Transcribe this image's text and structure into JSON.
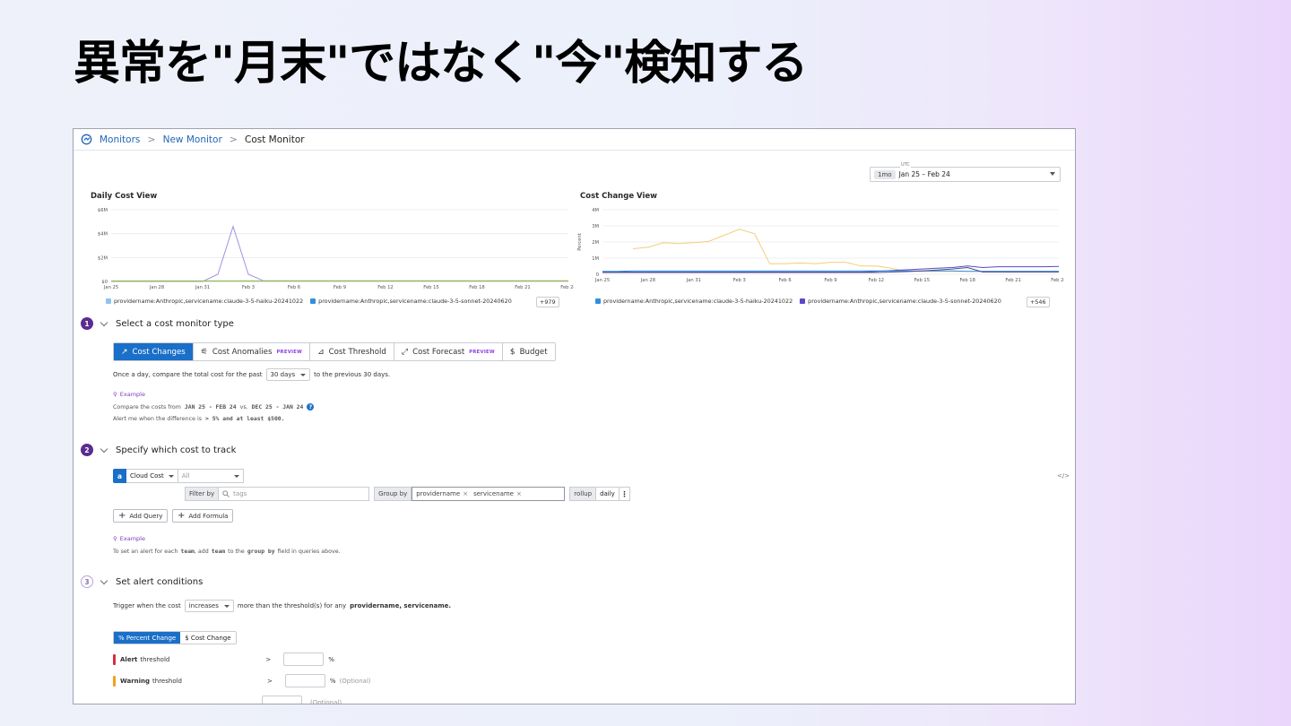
{
  "slide": {
    "title": "異常を\"月末\"ではなく\"今\"検知する"
  },
  "breadcrumb": {
    "monitors": "Monitors",
    "new_monitor": "New Monitor",
    "current": "Cost Monitor",
    "separator": ">"
  },
  "date_range": {
    "utc_label": "UTC",
    "badge": "1mo",
    "range": "Jan 25 – Feb 24"
  },
  "daily_cost_chart": {
    "title": "Daily Cost View",
    "more_badge": "+979",
    "legend": [
      "providername:Anthropic,servicename:claude-3-5-haiku-20241022",
      "providername:Anthropic,servicename:claude-3-5-sonnet-20240620"
    ],
    "colors": [
      "#8fc4f0",
      "#2f8fe0"
    ]
  },
  "cost_change_chart": {
    "title": "Cost Change View",
    "more_badge": "+546",
    "legend": [
      "providername:Anthropic,servicename:claude-3-5-haiku-20241022",
      "providername:Anthropic,servicename:claude-3-5-sonnet-20240620"
    ],
    "colors": [
      "#2f8fe0",
      "#5b47c7"
    ]
  },
  "chart_data": [
    {
      "type": "line",
      "title": "Daily Cost View",
      "xlabel": "",
      "ylabel": "",
      "x_ticks": [
        "Jan 25",
        "Jan 28",
        "Jan 31",
        "Feb 3",
        "Feb 6",
        "Feb 9",
        "Feb 12",
        "Feb 15",
        "Feb 18",
        "Feb 21",
        "Feb 24"
      ],
      "y_ticks": [
        "$6M",
        "$4M",
        "$2M",
        "$0"
      ],
      "ylim": [
        0,
        6
      ],
      "x": [
        0,
        1,
        2,
        3,
        4,
        5,
        6,
        7,
        8,
        9,
        10,
        11,
        12,
        13,
        14,
        15,
        16,
        17,
        18,
        19,
        20,
        21,
        22,
        23,
        24,
        25,
        26,
        27,
        28,
        29,
        30
      ],
      "series": [
        {
          "color": "#a48ee0",
          "values": [
            0,
            0,
            0,
            0,
            0,
            0,
            0,
            0.6,
            4.6,
            0.6,
            0.05,
            0.05,
            0.05,
            0.05,
            0.05,
            0.05,
            0.05,
            0.05,
            0.05,
            0.05,
            0.05,
            0.05,
            0.05,
            0.05,
            0.05,
            0.05,
            0.05,
            0.05,
            0.05,
            0.05,
            0.05
          ]
        },
        {
          "color": "#e8c66a",
          "values": [
            0.05,
            0.05,
            0.05,
            0.05,
            0.05,
            0.05,
            0.05,
            0.05,
            0.05,
            0.05,
            0.05,
            0.05,
            0.05,
            0.05,
            0.05,
            0.05,
            0.05,
            0.05,
            0.05,
            0.05,
            0.05,
            0.05,
            0.05,
            0.05,
            0.05,
            0.05,
            0.05,
            0.05,
            0.05,
            0.05,
            0.05
          ]
        },
        {
          "color": "#7ab86b",
          "values": [
            0.02,
            0.02,
            0.02,
            0.02,
            0.02,
            0.02,
            0.02,
            0.02,
            0.02,
            0.02,
            0.02,
            0.02,
            0.02,
            0.02,
            0.02,
            0.02,
            0.02,
            0.02,
            0.02,
            0.02,
            0.02,
            0.02,
            0.02,
            0.02,
            0.02,
            0.02,
            0.02,
            0.02,
            0.02,
            0.02,
            0.02
          ]
        }
      ]
    },
    {
      "type": "line",
      "title": "Cost Change View",
      "xlabel": "",
      "ylabel": "Percent",
      "x_ticks": [
        "Jan 25",
        "Jan 28",
        "Jan 31",
        "Feb 3",
        "Feb 6",
        "Feb 9",
        "Feb 12",
        "Feb 15",
        "Feb 18",
        "Feb 21",
        "Feb 24"
      ],
      "y_ticks": [
        "4M",
        "3M",
        "2M",
        "1M",
        "0"
      ],
      "ylim": [
        -0.1,
        4.2
      ],
      "x": [
        0,
        1,
        2,
        3,
        4,
        5,
        6,
        7,
        8,
        9,
        10,
        11,
        12,
        13,
        14,
        15,
        16,
        17,
        18,
        19,
        20,
        21,
        22,
        23,
        24,
        25,
        26,
        27,
        28,
        29,
        30
      ],
      "series": [
        {
          "color": "#f0cf78",
          "values": [
            null,
            null,
            1.6,
            1.7,
            2.0,
            1.95,
            2.0,
            2.1,
            2.5,
            2.9,
            2.6,
            0.6,
            0.6,
            0.65,
            0.6,
            0.7,
            0.7,
            0.45,
            0.45,
            0.3,
            0.1,
            0.1,
            0.1,
            0.1,
            0.1,
            0.1,
            0.1,
            0.1,
            0.1,
            0.1,
            0.1
          ]
        },
        {
          "color": "#5b47c7",
          "values": [
            0.05,
            0.05,
            0.05,
            0.05,
            0.05,
            0.05,
            0.05,
            0.05,
            0.05,
            0.05,
            0.05,
            0.05,
            0.05,
            0.05,
            0.05,
            0.05,
            0.05,
            0.05,
            0.1,
            0.15,
            0.2,
            0.25,
            0.3,
            0.35,
            0.45,
            0.35,
            0.4,
            0.4,
            0.4,
            0.4,
            0.42
          ]
        },
        {
          "color": "#2f8fe0",
          "values": [
            0.1,
            0.1,
            0.12,
            0.12,
            0.12,
            0.12,
            0.12,
            0.12,
            0.12,
            0.12,
            0.12,
            0.12,
            0.12,
            0.12,
            0.12,
            0.12,
            0.12,
            0.12,
            0.12,
            0.12,
            0.12,
            0.12,
            0.12,
            0.12,
            0.1,
            0.1,
            0.1,
            0.1,
            0.1,
            0.1,
            0.1
          ]
        },
        {
          "color": "#4a4a8a",
          "values": [
            0.02,
            0.02,
            0.02,
            0.02,
            0.02,
            0.02,
            0.02,
            0.02,
            0.02,
            0.02,
            0.02,
            0.02,
            0.02,
            0.02,
            0.02,
            0.02,
            0.02,
            0.02,
            0.02,
            0.05,
            0.08,
            0.12,
            0.18,
            0.25,
            0.35,
            0.05,
            0.05,
            0.05,
            0.05,
            0.05,
            0.05
          ]
        }
      ]
    }
  ],
  "step1": {
    "number": "1",
    "title": "Select a cost monitor type",
    "tabs": [
      {
        "label": "Cost Changes",
        "icon": "↗",
        "active": true,
        "preview": ""
      },
      {
        "label": "Cost Anomalies",
        "icon": "⚟",
        "active": false,
        "preview": "PREVIEW"
      },
      {
        "label": "Cost Threshold",
        "icon": "⊿",
        "active": false,
        "preview": ""
      },
      {
        "label": "Cost Forecast",
        "icon": "⤢",
        "active": false,
        "preview": "PREVIEW"
      },
      {
        "label": "Budget",
        "icon": "$",
        "active": false,
        "preview": ""
      }
    ],
    "compare_prefix": "Once a day, compare the total cost for the past",
    "compare_period": "30 days",
    "compare_suffix": "to the previous 30 days.",
    "example_label": "Example",
    "example_line1_prefix": "Compare the costs from",
    "example_line1_range1": "JAN 25 - FEB 24",
    "example_line1_vs": "vs.",
    "example_line1_range2": "DEC 25 - JAN 24",
    "example_line2_prefix": "Alert me when the difference is",
    "example_line2_value": "> 5% and at least $500."
  },
  "step2": {
    "number": "2",
    "title": "Specify which cost to track",
    "query_letter": "a",
    "source": "Cloud Cost",
    "all_placeholder": "All",
    "filter_label": "Filter by",
    "filter_placeholder": "tags",
    "group_label": "Group by",
    "group_tags": [
      "providername",
      "servicename"
    ],
    "rollup_label": "rollup",
    "rollup_value": "daily",
    "add_query": "Add Query",
    "add_formula": "Add Formula",
    "code_icon": "</>",
    "example_label": "Example",
    "example_prefix": "To set an alert for each",
    "example_team1": "team",
    "example_mid1": ", add",
    "example_team2": "team",
    "example_mid2": "to the",
    "example_groupby": "group by",
    "example_suffix": "field in queries above."
  },
  "step3": {
    "number": "3",
    "title": "Set alert conditions",
    "trigger_prefix": "Trigger when the cost",
    "trigger_value": "increases",
    "trigger_suffix": "more than the threshold(s) for any",
    "trigger_fields": "providername, servicename.",
    "seg_percent": "% Percent Change",
    "seg_cost": "$ Cost Change",
    "alert_bold": "Alert",
    "alert_rest": "threshold",
    "warning_bold": "Warning",
    "warning_rest": "threshold",
    "gt": ">",
    "pct": "%",
    "optional": "(Optional)",
    "alert_color": "#d6303b",
    "warning_color": "#f0a21b"
  }
}
